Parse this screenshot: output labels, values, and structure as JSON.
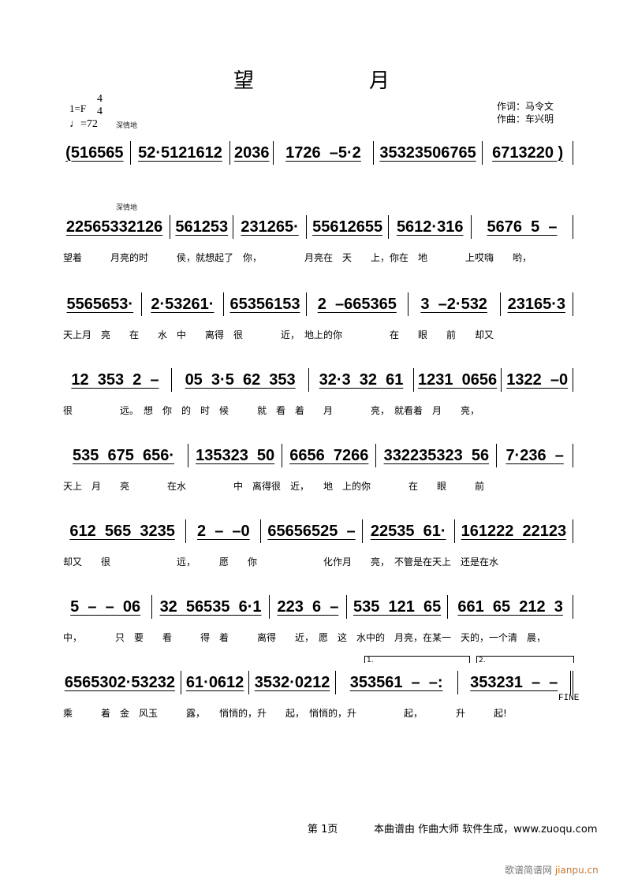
{
  "title": "望　月",
  "key": "1=F",
  "time_signature": {
    "top": "4",
    "bottom": "4"
  },
  "tempo": "=72",
  "expression": "深情地",
  "credits": {
    "lyricist": "作词：马令文",
    "composer": "作曲：车兴明"
  },
  "systems": [
    {
      "measures": [
        "(516565",
        "52·5121612",
        "2036",
        "1726  –5·2",
        "35323506765",
        "6713220 )"
      ],
      "lyrics": ""
    },
    {
      "measures": [
        "22565332126",
        "561253",
        "231265·",
        "55612655",
        "5612·316",
        "5676  5  –"
      ],
      "lyrics": "望着　　　月亮的时　　　侯，就想起了　你，　　　　　月亮在　天　　上，你在　地　　　　上哎嗨　　哟，"
    },
    {
      "measures": [
        "5565653·",
        "2·53261·",
        "65356153",
        "2  –665365",
        "3  –2·532",
        "23165·3"
      ],
      "lyrics": "天上月　亮　　在　　水　中　　离得　很　　　　近，　地上的你　　　　　在　　眼　　前　　却又"
    },
    {
      "measures": [
        "12  353  2  –",
        "05  3·5  62  353",
        "32·3  32  61",
        "1231  0656",
        "1322  –0"
      ],
      "lyrics": "很　　　　　远。　想　你　的　时　候　　　就　看　着　　月　　　　亮，　就看着　月　　亮，"
    },
    {
      "measures": [
        "535  675  656·",
        "135323  50",
        "6656  7266",
        "332235323  56",
        "7·236  –"
      ],
      "lyrics": "天上　月　　亮　　　　在水　　　　　中　离得很　近，　　地　上的你　　　　在　　眼　　　前"
    },
    {
      "measures": [
        "612  565  3235",
        "2  –  –0",
        "65656525  –",
        "22535  61·",
        "161222  22123"
      ],
      "lyrics": "却又　　很　　　　　　　远，　　　愿　　你　　　　　　　化作月　　亮，　不管是在天上　还是在水"
    },
    {
      "measures": [
        "5  –  –  06",
        "32  56535  6·1",
        "223  6  –",
        "535  121  65",
        "661  65  212  3"
      ],
      "lyrics": "中，　　　　只　要　　看　　　得　着　　　离得　　近，　愿　这　水中的　月亮，在某一　天的，一个清　晨，"
    },
    {
      "measures": [
        "6565302·53232",
        "61·0612",
        "3532·0212",
        "353561  –  –:",
        "353231  –  –"
      ],
      "lyrics": "乘　　　着　金　风玉　　　露，　　悄悄的，升　　起，　悄悄的，升　　　　　起，　　　　升　　　起!"
    }
  ],
  "voltas": [
    "1.",
    "2."
  ],
  "fine": "FINE",
  "footer": {
    "page": "第 1页",
    "generator": "本曲谱由 作曲大师 软件生成，www.zuoqu.com"
  },
  "watermark": {
    "site_cn": "歌谱简谱网",
    "site": "jianpu.cn"
  }
}
